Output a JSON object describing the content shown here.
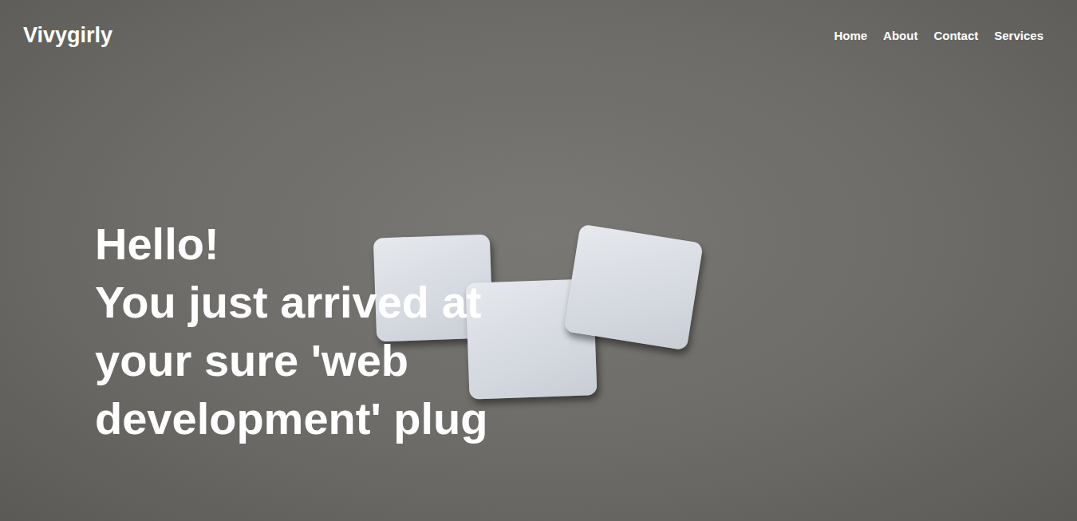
{
  "brand": "Vivygirly",
  "nav": {
    "items": [
      "Home",
      "About",
      "Contact",
      "Services"
    ]
  },
  "hero": {
    "greeting": "Hello!",
    "tagline": "You just arrived at your sure 'web development' plug"
  }
}
